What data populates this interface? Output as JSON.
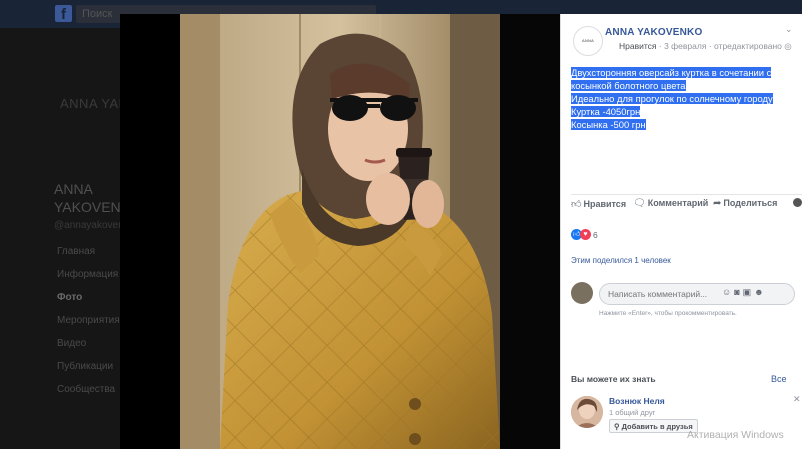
{
  "background": {
    "search_placeholder": "Поиск",
    "brand": "ANNA YAKOVENKO",
    "page_name": "ANNA YAKOVENKO",
    "handle": "@annayakovenko",
    "nav": [
      {
        "label": "Главная"
      },
      {
        "label": "Информация"
      },
      {
        "label": "Фото"
      },
      {
        "label": "Мероприятия"
      },
      {
        "label": "Видео"
      },
      {
        "label": "Публикации"
      },
      {
        "label": "Сообщества"
      }
    ]
  },
  "post": {
    "page_avatar_text": "ANNA YAKOVENKO",
    "page_name": "ANNA YAKOVENKO",
    "like_link": "Нравится",
    "date": "3 февраля",
    "edited": "отредактировано",
    "text_lines": [
      "Двухсторонняя оверсайз куртка в сочетании с",
      "косынкой болотного цвета",
      "Идеально для прогулок по солнечному городу",
      "Куртка -4050грн",
      "Косынка -500 грн"
    ],
    "actions": {
      "like": "Нравится",
      "comment": "Комментарий",
      "share": "Поделиться"
    },
    "reactions_count": "6",
    "shares_text": "Этим поделился 1 человек",
    "comment_placeholder": "Написать комментарий...",
    "comment_hint": "Нажмите «Enter», чтобы прокомментировать."
  },
  "suggestions": {
    "title": "Вы можете их знать",
    "see_all": "Все",
    "friend": {
      "name": "Вознюк Неля",
      "mutual": "1 общий друг",
      "add_button": "Добавить в друзья"
    }
  },
  "watermark": "Активация Windows",
  "colors": {
    "link": "#365899",
    "selection": "#2f6ff0",
    "overlay": "#000000",
    "like_blue": "#1877f2",
    "love_red": "#f33e58"
  }
}
